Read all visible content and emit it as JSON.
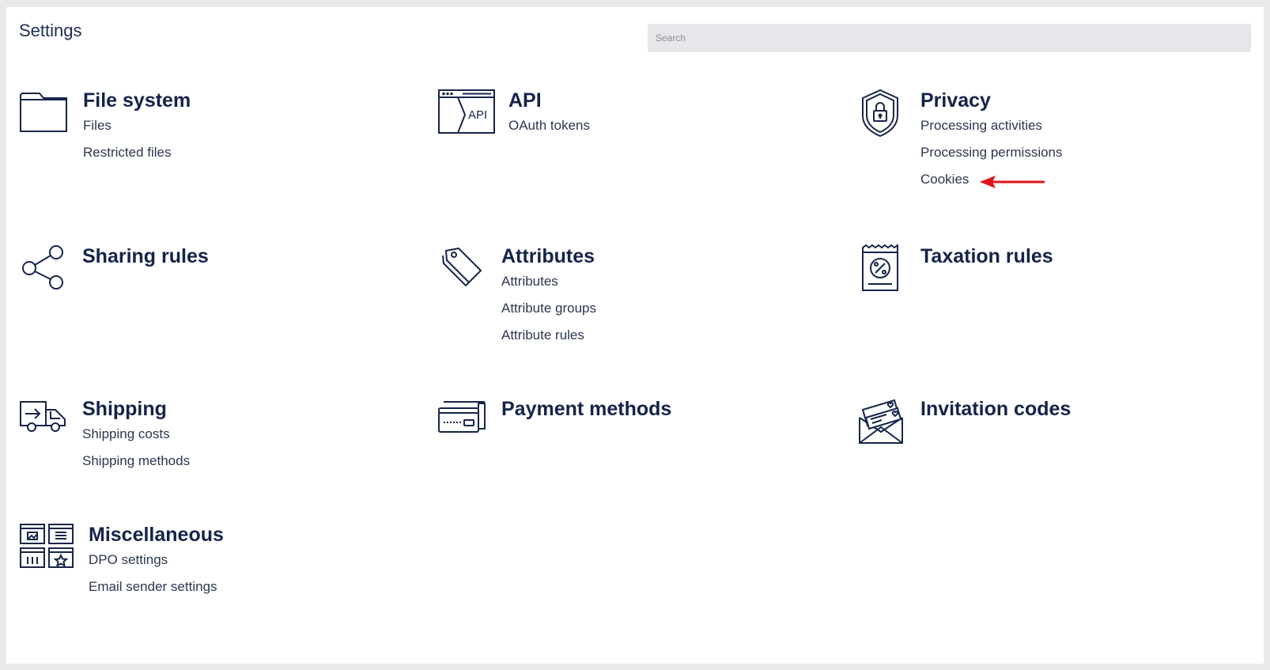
{
  "header": {
    "title": "Settings",
    "search_placeholder": "Search"
  },
  "sections": [
    {
      "title": "File system",
      "icon": "folder-icon",
      "links": [
        "Files",
        "Restricted files"
      ]
    },
    {
      "title": "API",
      "icon": "api-icon",
      "icon_text": "API",
      "links": [
        "OAuth tokens"
      ]
    },
    {
      "title": "Privacy",
      "icon": "shield-lock-icon",
      "links": [
        "Processing activities",
        "Processing permissions",
        "Cookies"
      ]
    },
    {
      "title": "Sharing rules",
      "icon": "share-icon",
      "links": []
    },
    {
      "title": "Attributes",
      "icon": "tags-icon",
      "links": [
        "Attributes",
        "Attribute groups",
        "Attribute rules"
      ]
    },
    {
      "title": "Taxation rules",
      "icon": "tax-receipt-icon",
      "links": []
    },
    {
      "title": "Shipping",
      "icon": "delivery-truck-icon",
      "links": [
        "Shipping costs",
        "Shipping methods"
      ]
    },
    {
      "title": "Payment methods",
      "icon": "credit-card-icon",
      "links": []
    },
    {
      "title": "Invitation codes",
      "icon": "invitation-envelope-icon",
      "links": []
    },
    {
      "title": "Miscellaneous",
      "icon": "widgets-grid-icon",
      "links": [
        "DPO settings",
        "Email sender settings"
      ]
    }
  ],
  "colors": {
    "heading": "#14234a",
    "link": "#2c3650",
    "annotation_arrow": "#e3141b",
    "search_bg": "#e6e6eb"
  }
}
